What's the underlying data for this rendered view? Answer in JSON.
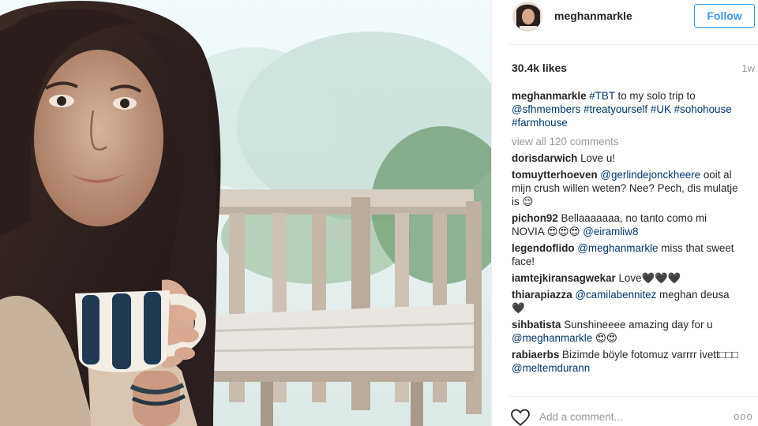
{
  "post": {
    "username": "meghanmarkle",
    "follow_label": "Follow",
    "likes": "30.4k likes",
    "time_ago": "1w",
    "caption": {
      "username": "meghanmarkle",
      "text_1": "#TBT",
      "text_2": " to my solo trip to ",
      "text_3": "@sfhmembers",
      "text_4": " ",
      "text_5": "#treatyourself",
      "text_6": " ",
      "text_7": "#UK",
      "text_8": " ",
      "text_9": "#sohohouse",
      "text_10": " ",
      "text_11": "#farmhouse"
    },
    "view_all": "view all 120 comments",
    "comments": [
      {
        "user": "dorisdarwich",
        "text": "Love u!"
      },
      {
        "user": "tomuytterhoeven",
        "mention": "@gerlindejonckheere",
        "text": " ooit al mijn crush willen weten? Nee? Pech, dis mulatje is 😌"
      },
      {
        "user": "pichon92",
        "text": "Bellaaaaaaa, no tanto como mi NOVIA 😍😍😍 ",
        "mention": "@eiramliw8"
      },
      {
        "user": "legendoflido",
        "mention": "@meghanmarkle",
        "text": " miss that sweet face!"
      },
      {
        "user": "iamtejkiransagwekar",
        "text": "Love🖤🖤🖤"
      },
      {
        "user": "thiarapiazza",
        "mention": "@camilabennitez",
        "text": " meghan deusa 🖤"
      },
      {
        "user": "sihbatista",
        "text": "Sunshineeee amazing day for u ",
        "mention": "@meghanmarkle",
        "text_after": " 😍😍"
      },
      {
        "user": "rabiaerbs",
        "text": "Bizimde böyle fotomuz varrrr ivett□□□  ",
        "mention": "@meltemdurann"
      }
    ],
    "add_comment_placeholder": "Add a comment...",
    "more_label": "ooo"
  },
  "icons": {
    "like": "heart-outline-icon",
    "more": "more-options-icon"
  },
  "colors": {
    "follow_blue": "#3897f0",
    "link": "#003569",
    "muted": "#999999"
  }
}
